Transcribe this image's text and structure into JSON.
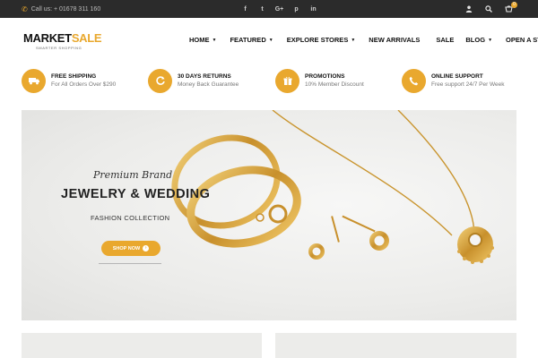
{
  "topbar": {
    "call_text": "Call us: + 01678 311 160",
    "social": [
      {
        "label": "f",
        "icon": "facebook-icon"
      },
      {
        "label": "t",
        "icon": "twitter-icon"
      },
      {
        "label": "G+",
        "icon": "google-plus-icon"
      },
      {
        "label": "p",
        "icon": "pinterest-icon"
      },
      {
        "label": "in",
        "icon": "linkedin-icon"
      }
    ],
    "cart_count": "0"
  },
  "logo": {
    "name_part1": "MARKET",
    "name_part2": "SALE",
    "tagline": "SMARTER SHOPPING"
  },
  "nav": [
    {
      "label": "HOME",
      "dropdown": true
    },
    {
      "label": "FEATURED",
      "dropdown": true
    },
    {
      "label": "EXPLORE STORES",
      "dropdown": true
    },
    {
      "label": "NEW ARRIVALS",
      "dropdown": false
    },
    {
      "label": "SALE",
      "dropdown": false
    },
    {
      "label": "BLOG",
      "dropdown": true
    },
    {
      "label": "OPEN A STORE",
      "dropdown": false
    }
  ],
  "features": [
    {
      "title": "FREE SHIPPING",
      "desc": "For All Orders Over $290",
      "icon": "truck-icon"
    },
    {
      "title": "30 DAYS RETURNS",
      "desc": "Money Back Guarantee",
      "icon": "return-icon"
    },
    {
      "title": "PROMOTIONS",
      "desc": "10% Member Discount",
      "icon": "gift-icon"
    },
    {
      "title": "ONLINE SUPPORT",
      "desc": "Free support 24/7 Per Week",
      "icon": "phone-icon"
    }
  ],
  "hero": {
    "brand": "Premium Brand",
    "title": "JEWELRY & WEDDING",
    "subtitle": "FASHION COLLECTION",
    "button": "SHOP NOW"
  },
  "colors": {
    "accent": "#e9a82e",
    "topbar": "#2b2b2b"
  }
}
